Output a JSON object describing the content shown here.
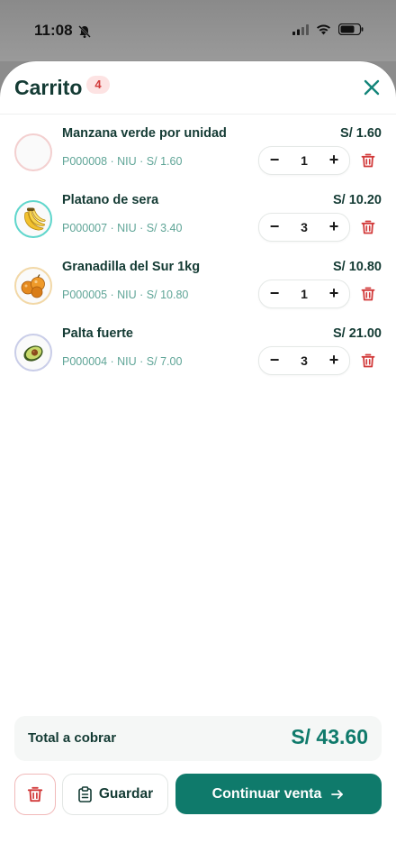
{
  "status_bar": {
    "time": "11:08"
  },
  "cart": {
    "title": "Carrito",
    "count": "4",
    "items": [
      {
        "name": "Manzana verde por unidad",
        "meta": "P000008 · NIU · S/ 1.60",
        "price": "S/ 1.60",
        "qty": "1",
        "thumb": "empty",
        "ring": "#f3cfcf"
      },
      {
        "name": "Platano de sera",
        "meta": "P000007 · NIU · S/ 3.40",
        "price": "S/ 10.20",
        "qty": "3",
        "thumb": "banana-icon",
        "ring": "#5fd6cc"
      },
      {
        "name": "Granadilla del Sur 1kg",
        "meta": "P000005 · NIU · S/ 10.80",
        "price": "S/ 10.80",
        "qty": "1",
        "thumb": "granadilla-icon",
        "ring": "#f2d8a7"
      },
      {
        "name": "Palta fuerte",
        "meta": "P000004 · NIU · S/ 7.00",
        "price": "S/ 21.00",
        "qty": "3",
        "thumb": "avocado-icon",
        "ring": "#c9cde8"
      }
    ],
    "stepper": {
      "minus": "−",
      "plus": "+"
    },
    "total_label": "Total a cobrar",
    "total_value": "S/ 43.60",
    "save_label": "Guardar",
    "continue_label": "Continuar venta"
  },
  "colors": {
    "accent": "#0f7a6b",
    "danger": "#d23a3a",
    "text": "#143b34",
    "meta": "#5fa597"
  }
}
